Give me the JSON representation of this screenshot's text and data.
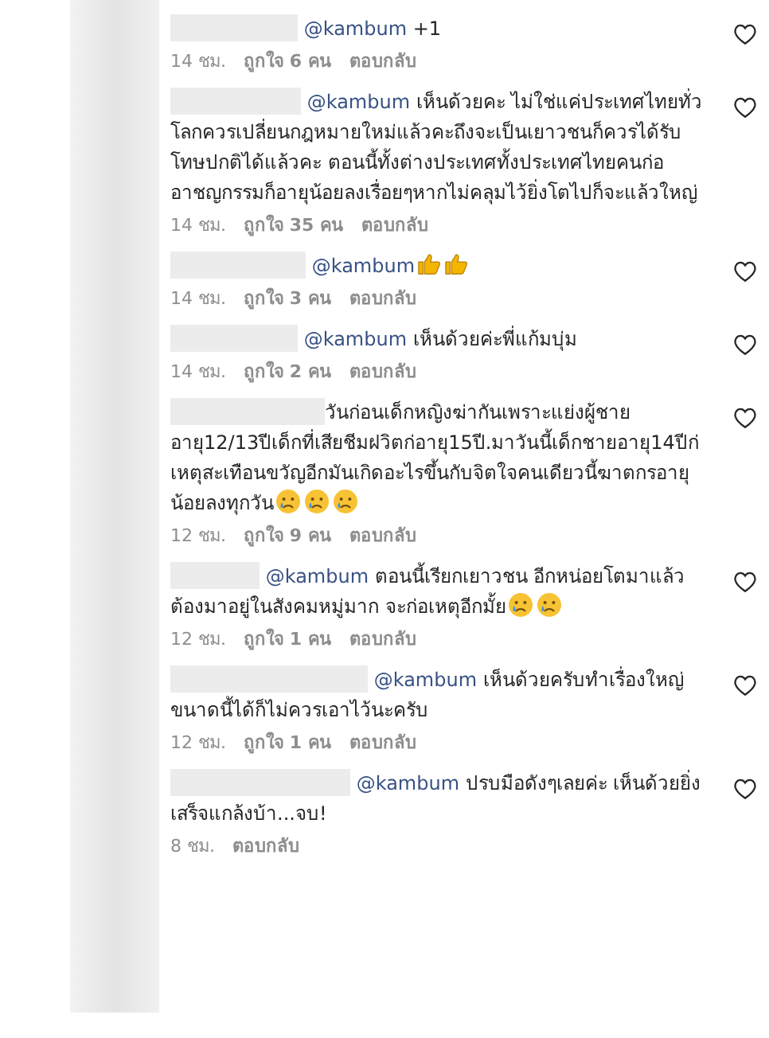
{
  "comments": [
    {
      "mention": "@kambum",
      "text": " +1",
      "time": "14 ชม.",
      "likes": "ถูกใจ 6 คน",
      "reply": "ตอบกลับ",
      "liked": false
    },
    {
      "mention": "@kambum",
      "text": " เห็นด้วยคะ ไม่ใช่แค่ประเทศไทยทั่วโลกควรเปลี่ยนกฎหมายใหม่แล้วคะถึงจะเป็นเยาวชนก็ควรได้รับโทษปกติได้แล้วคะ ตอนนี้ทั้งต่างประเทศทั้งประเทศไทยคนก่ออาชญกรรมก็อายุน้อยลงเรื่อยๆหากไม่คลุมไว้ยิ่งโตไปก็จะแล้วใหญ่",
      "time": "14 ชม.",
      "likes": "ถูกใจ 35 คน",
      "reply": "ตอบกลับ",
      "liked": false
    },
    {
      "mention": "@kambum",
      "emoji": [
        {
          "kind": "thumbs_up"
        },
        {
          "kind": "thumbs_up"
        }
      ],
      "time": "14 ชม.",
      "likes": "ถูกใจ 3 คน",
      "reply": "ตอบกลับ",
      "liked": false
    },
    {
      "mention": "@kambum",
      "text": " เห็นด้วยค่ะพี่แก้มบุ่ม",
      "time": "14 ชม.",
      "likes": "ถูกใจ 2 คน",
      "reply": "ตอบกลับ",
      "liked": false
    },
    {
      "text": "วันก่อนเด็กหญิงฆ่ากันเพราะแย่งผู้ชายอายุ12/13ปีเด็กที่เสียชีมฝวิตก่อายุ15ปี.มาวันนี้เด็กชายอายุ14ปีก่เหตุสะเทือนขวัญอีกมันเกิดอะไรขึ้นกับจิตใจคนเดียวนี้ฆาตกรอายุน้อยลงทุกวัน",
      "emoji": [
        {
          "kind": "crying"
        },
        {
          "kind": "crying"
        },
        {
          "kind": "crying"
        }
      ],
      "time": "12 ชม.",
      "likes": "ถูกใจ 9 คน",
      "reply": "ตอบกลับ",
      "liked": false
    },
    {
      "mention": "@kambum",
      "text": " ตอนนี้เรียกเยาวชน อีกหน่อยโตมาแล้วต้องมาอยู่ในสังคมหมู่มาก จะก่อเหตุอีกมั้ย",
      "emoji": [
        {
          "kind": "crying"
        },
        {
          "kind": "crying"
        }
      ],
      "time": "12 ชม.",
      "likes": "ถูกใจ 1 คน",
      "reply": "ตอบกลับ",
      "liked": false
    },
    {
      "mention": "@kambum",
      "text": " เห็นด้วยครับทำเรื่องใหญ่ขนาดนี้ได้ก็ไม่ควรเอาไว้นะครับ",
      "time": "12 ชม.",
      "likes": "ถูกใจ 1 คน",
      "reply": "ตอบกลับ",
      "liked": false
    },
    {
      "mention": "@kambum",
      "text": " ปรบมือดังๆเลยค่ะ เห็นด้วยยิ่งเสร็จแกล้งบ้า...จบ!",
      "time": "8 ชม.",
      "reply": "ตอบกลับ",
      "liked": false
    }
  ]
}
